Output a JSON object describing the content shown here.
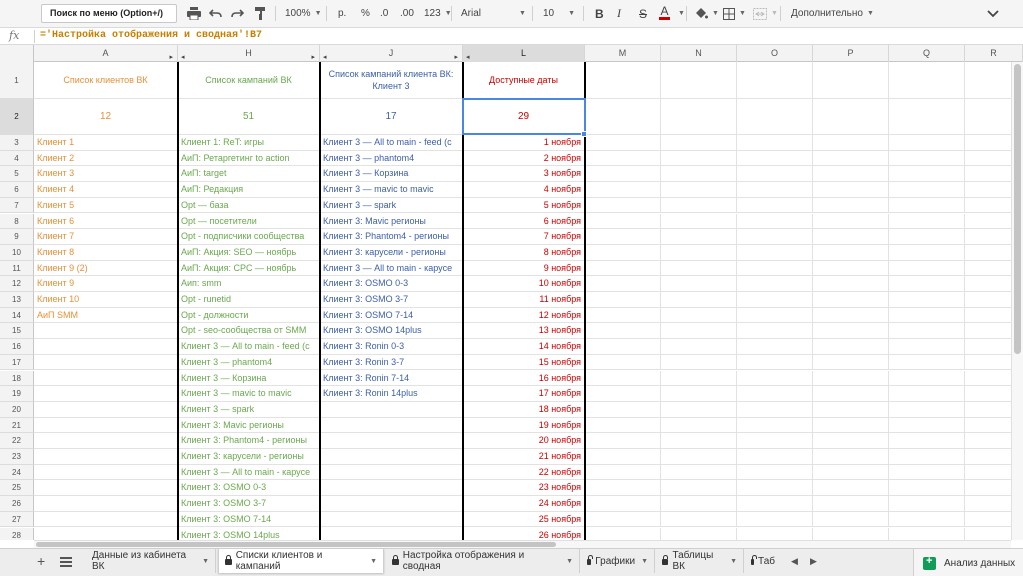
{
  "toolbar": {
    "menu_search": "Поиск по меню (Option+/)",
    "zoom": "100%",
    "currency": "р.",
    "percent": "%",
    "decimal_dec": ".0",
    "decimal_inc": ".00",
    "more_formats": "123",
    "font": "Arial",
    "font_size": "10",
    "bold": "B",
    "italic": "I",
    "strike": "S",
    "text_color": "A",
    "more": "Дополнительно"
  },
  "formula_bar": {
    "fx": "fx",
    "content": "='Настройка отображения и сводная'!B7"
  },
  "columns": [
    "A",
    "H",
    "J",
    "L",
    "M",
    "N",
    "O",
    "P",
    "Q",
    "R"
  ],
  "rows": [
    "1",
    "2",
    "3",
    "4",
    "5",
    "6",
    "7",
    "8",
    "9",
    "10",
    "11",
    "12",
    "13",
    "14",
    "15",
    "16",
    "17",
    "18",
    "19",
    "20",
    "21",
    "22",
    "23",
    "24",
    "25",
    "26",
    "27",
    "28"
  ],
  "header": {
    "a": "Список клиентов ВК",
    "h": "Список кампаний ВК",
    "j": "Список кампаний клиента ВК: Клиент 3",
    "l": "Доступные даты"
  },
  "counts": {
    "a": "12",
    "h": "51",
    "j": "17",
    "l": "29"
  },
  "col_a": [
    "Клиент 1",
    "Клиент 2",
    "Клиент 3",
    "Клиент 4",
    "Клиент 5",
    "Клиент 6",
    "Клиент 7",
    "Клиент 8",
    "Клиент 9 (2)",
    "Клиент 9",
    "Клиент 10",
    "АиП SMM"
  ],
  "col_h": [
    "Клиент 1: ReT: игры",
    "АиП: Ретаргетинг to action",
    "АиП: target",
    "АиП: Редакция",
    "Opt — база",
    "Opt — посетители",
    "Opt - подписчики сообщества",
    "АиП: Акция: SEO — ноябрь",
    "АиП: Акция: CPC — ноябрь",
    "Аип: smm",
    "Opt - runetid",
    "Opt - должности",
    "Opt - seo-сообщества от SMM",
    "Клиент 3 — All to main - feed (с",
    "Клиент 3 — phantom4",
    "Клиент 3 — Корзина",
    "Клиент 3 — mavic to mavic",
    "Клиент 3 — spark",
    "Клиент 3: Mavic регионы",
    "Клиент 3: Phantom4 - регионы",
    "Клиент 3: карусели - регионы",
    "Клиент 3 — All to main - карусе",
    "Клиент 3: OSMO 0-3",
    "Клиент 3: OSMO 3-7",
    "Клиент 3: OSMO 7-14",
    "Клиент 3: OSMO 14plus"
  ],
  "col_j": [
    "Клиент 3 — All to main - feed (с",
    "Клиент 3 — phantom4",
    "Клиент 3 — Корзина",
    "Клиент 3 — mavic to mavic",
    "Клиент 3 — spark",
    "Клиент 3: Mavic регионы",
    "Клиент 3: Phantom4 - регионы",
    "Клиент 3: карусели - регионы",
    "Клиент 3 — All to main - карусе",
    "Клиент 3: OSMO 0-3",
    "Клиент 3: OSMO 3-7",
    "Клиент 3: OSMO 7-14",
    "Клиент 3: OSMO 14plus",
    "Клиент 3: Ronin 0-3",
    "Клиент 3: Ronin 3-7",
    "Клиент 3: Ronin 7-14",
    "Клиент 3: Ronin 14plus"
  ],
  "col_l": [
    "1 ноября",
    "2 ноября",
    "3 ноября",
    "4 ноября",
    "5 ноября",
    "6 ноября",
    "7 ноября",
    "8 ноября",
    "9 ноября",
    "10 ноября",
    "11 ноября",
    "12 ноября",
    "13 ноября",
    "14 ноября",
    "15 ноября",
    "16 ноября",
    "17 ноября",
    "18 ноября",
    "19 ноября",
    "20 ноября",
    "21 ноября",
    "22 ноября",
    "23 ноября",
    "24 ноября",
    "25 ноября",
    "26 ноября"
  ],
  "tabs": [
    "Данные из кабинета ВК",
    "Списки клиентов и кампаний",
    "Настройка отображения и сводная",
    "Графики",
    "Таблицы ВК",
    "Таб"
  ],
  "explore": "Анализ данных",
  "colors": {
    "orange": "#e69138",
    "green": "#6aa84f",
    "blue": "#3c5fa8",
    "red": "#cc0000",
    "selection": "#4a86e8"
  }
}
